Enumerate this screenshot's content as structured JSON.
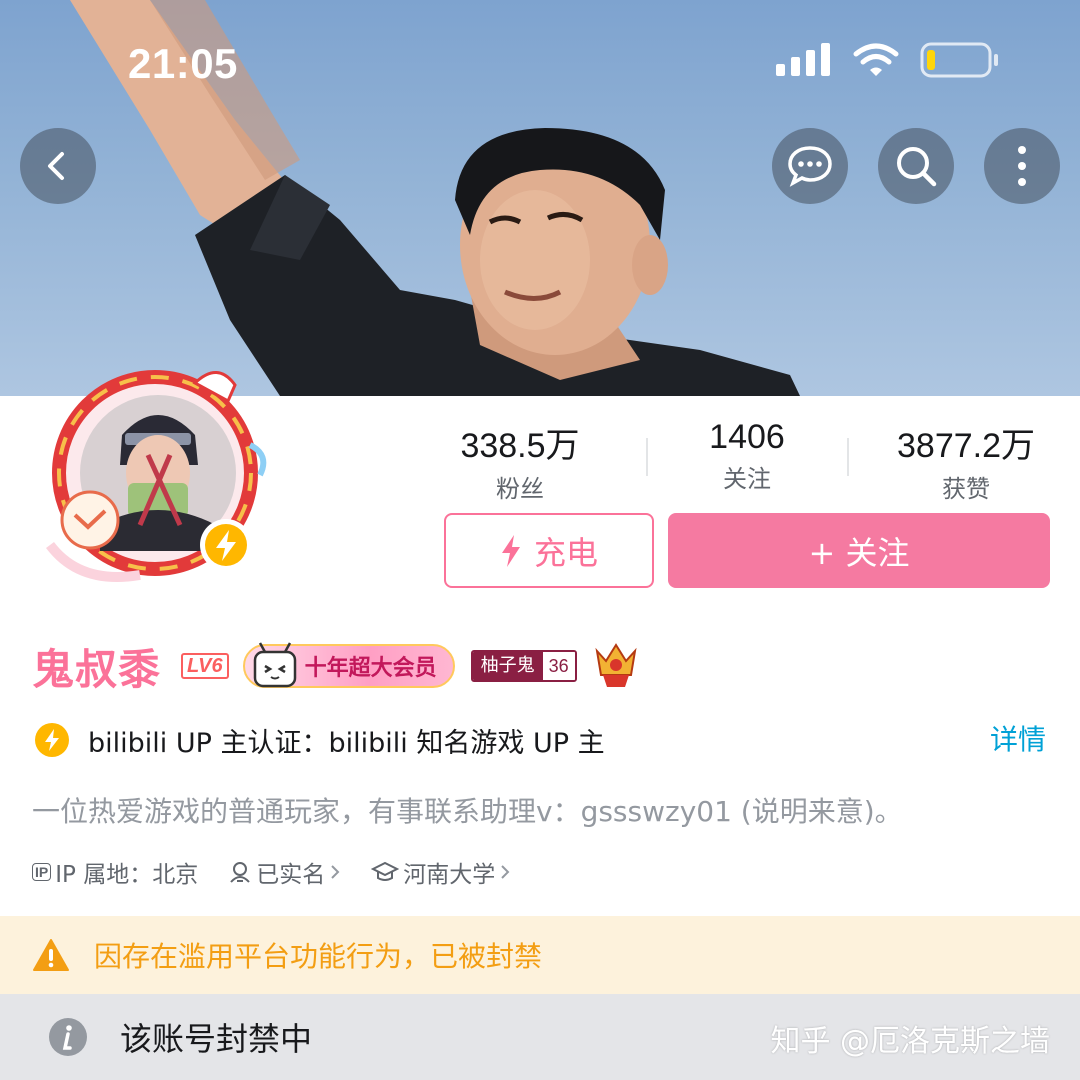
{
  "status_bar": {
    "time": "21:05"
  },
  "nav": {
    "back_icon": "chevron-left-icon",
    "message_icon": "chat-bubble-icon",
    "search_icon": "search-icon",
    "more_icon": "more-vertical-icon"
  },
  "stats": [
    {
      "value": "338.5万",
      "label": "粉丝"
    },
    {
      "value": "1406",
      "label": "关注"
    },
    {
      "value": "3877.2万",
      "label": "获赞"
    }
  ],
  "actions": {
    "charge_label": "充电",
    "follow_label": "+ 关注"
  },
  "profile": {
    "username": "鬼叔黍",
    "level": "LV6",
    "vip_label": "十年超大会员",
    "fan_medal_name": "柚子鬼",
    "fan_medal_level": "36"
  },
  "verify": {
    "text": "bilibili UP 主认证：bilibili 知名游戏 UP 主",
    "detail_label": "详情"
  },
  "bio": "一位热爱游戏的普通玩家，有事联系助理v：gssswzy01 (说明来意)。",
  "meta": {
    "ip_tag": "IP",
    "ip_label": "IP 属地：北京",
    "realname_label": "已实名",
    "school_label": "河南大学"
  },
  "ban": {
    "warning_text": "因存在滥用平台功能行为，已被封禁",
    "status_text": "该账号封禁中"
  },
  "watermark": "知乎 @厄洛克斯之墙",
  "colors": {
    "brand_pink": "#fb7299",
    "follow_button": "#f57aa1",
    "link_blue": "#00a1d6",
    "warning_orange": "#f39e13",
    "warning_bg": "#fdf2dc",
    "status_bg": "#e4e5e8"
  }
}
